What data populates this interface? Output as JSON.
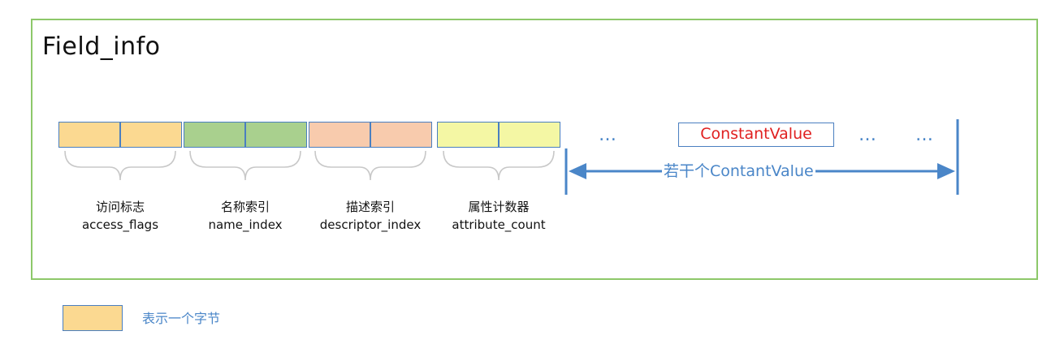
{
  "title": "Field_info",
  "colors": {
    "frame": "#8dc86a",
    "cell_border": "#4a7fc0",
    "access_flags": "#fbd991",
    "name_index": "#a9d08e",
    "descriptor_index": "#f8cbad",
    "attribute_count": "#f4f7a4",
    "accent_blue": "#4a86c8",
    "constant_value_text": "#e02020"
  },
  "fields": [
    {
      "cn": "访问标志",
      "en": "access_flags"
    },
    {
      "cn": "名称索引",
      "en": "name_index"
    },
    {
      "cn": "描述索引",
      "en": "descriptor_index"
    },
    {
      "cn": "属性计数器",
      "en": "attribute_count"
    }
  ],
  "dots": [
    "…",
    "…",
    "…"
  ],
  "constant_value": "ConstantValue",
  "arrow_label": "若干个ContantValue",
  "legend": {
    "text": "表示一个字节"
  }
}
